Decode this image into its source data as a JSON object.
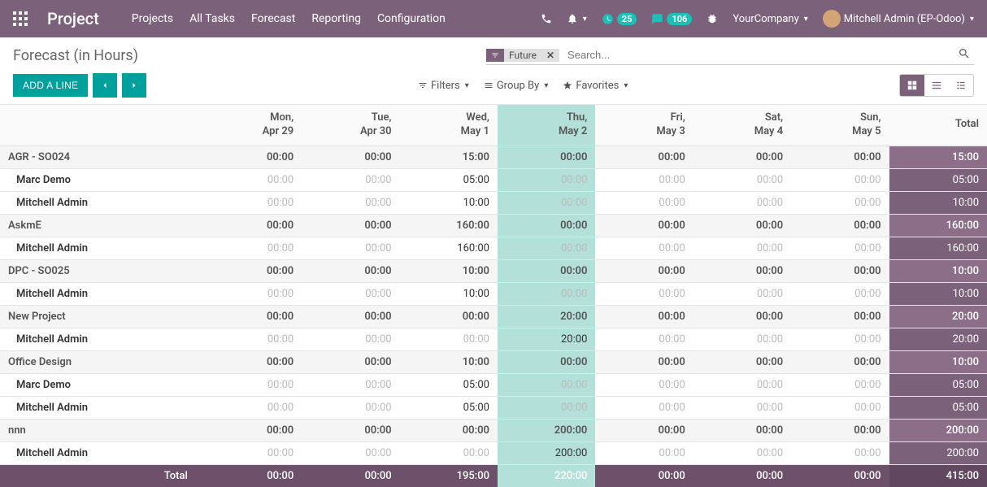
{
  "navbar": {
    "brand": "Project",
    "menu": [
      "Projects",
      "All Tasks",
      "Forecast",
      "Reporting",
      "Configuration"
    ],
    "activity_count": "25",
    "discuss_count": "106",
    "company": "YourCompany",
    "user": "Mitchell Admin (EP-Odoo)"
  },
  "page": {
    "title": "Forecast (in Hours)",
    "add_line": "ADD A LINE",
    "search_placeholder": "Search...",
    "facet_label": "Future",
    "filters": "Filters",
    "group_by": "Group By",
    "favorites": "Favorites"
  },
  "columns": [
    {
      "l1": "Mon,",
      "l2": "Apr 29",
      "today": false
    },
    {
      "l1": "Tue,",
      "l2": "Apr 30",
      "today": false
    },
    {
      "l1": "Wed,",
      "l2": "May 1",
      "today": false
    },
    {
      "l1": "Thu,",
      "l2": "May 2",
      "today": true
    },
    {
      "l1": "Fri,",
      "l2": "May 3",
      "today": false
    },
    {
      "l1": "Sat,",
      "l2": "May 4",
      "today": false
    },
    {
      "l1": "Sun,",
      "l2": "May 5",
      "today": false
    }
  ],
  "total_label": "Total",
  "groups": [
    {
      "name": "AGR - SO024",
      "cells": [
        "00:00",
        "00:00",
        "15:00",
        "00:00",
        "00:00",
        "00:00",
        "00:00"
      ],
      "total": "15:00",
      "rows": [
        {
          "name": "Marc Demo",
          "cells": [
            "00:00",
            "00:00",
            "05:00",
            "00:00",
            "00:00",
            "00:00",
            "00:00"
          ],
          "total": "05:00",
          "nz": [
            2
          ]
        },
        {
          "name": "Mitchell Admin",
          "cells": [
            "00:00",
            "00:00",
            "10:00",
            "00:00",
            "00:00",
            "00:00",
            "00:00"
          ],
          "total": "10:00",
          "nz": [
            2
          ]
        }
      ]
    },
    {
      "name": "AskmE",
      "cells": [
        "00:00",
        "00:00",
        "160:00",
        "00:00",
        "00:00",
        "00:00",
        "00:00"
      ],
      "total": "160:00",
      "rows": [
        {
          "name": "Mitchell Admin",
          "cells": [
            "00:00",
            "00:00",
            "160:00",
            "00:00",
            "00:00",
            "00:00",
            "00:00"
          ],
          "total": "160:00",
          "nz": [
            2
          ]
        }
      ]
    },
    {
      "name": "DPC - SO025",
      "cells": [
        "00:00",
        "00:00",
        "10:00",
        "00:00",
        "00:00",
        "00:00",
        "00:00"
      ],
      "total": "10:00",
      "rows": [
        {
          "name": "Mitchell Admin",
          "cells": [
            "00:00",
            "00:00",
            "10:00",
            "00:00",
            "00:00",
            "00:00",
            "00:00"
          ],
          "total": "10:00",
          "nz": [
            2
          ]
        }
      ]
    },
    {
      "name": "New Project",
      "cells": [
        "00:00",
        "00:00",
        "00:00",
        "20:00",
        "00:00",
        "00:00",
        "00:00"
      ],
      "total": "20:00",
      "rows": [
        {
          "name": "Mitchell Admin",
          "cells": [
            "00:00",
            "00:00",
            "00:00",
            "20:00",
            "00:00",
            "00:00",
            "00:00"
          ],
          "total": "20:00",
          "nz": [
            3
          ]
        }
      ]
    },
    {
      "name": "Office Design",
      "cells": [
        "00:00",
        "00:00",
        "10:00",
        "00:00",
        "00:00",
        "00:00",
        "00:00"
      ],
      "total": "10:00",
      "rows": [
        {
          "name": "Marc Demo",
          "cells": [
            "00:00",
            "00:00",
            "05:00",
            "00:00",
            "00:00",
            "00:00",
            "00:00"
          ],
          "total": "05:00",
          "nz": [
            2
          ]
        },
        {
          "name": "Mitchell Admin",
          "cells": [
            "00:00",
            "00:00",
            "05:00",
            "00:00",
            "00:00",
            "00:00",
            "00:00"
          ],
          "total": "05:00",
          "nz": [
            2
          ]
        }
      ]
    },
    {
      "name": "nnn",
      "cells": [
        "00:00",
        "00:00",
        "00:00",
        "200:00",
        "00:00",
        "00:00",
        "00:00"
      ],
      "total": "200:00",
      "rows": [
        {
          "name": "Mitchell Admin",
          "cells": [
            "00:00",
            "00:00",
            "00:00",
            "200:00",
            "00:00",
            "00:00",
            "00:00"
          ],
          "total": "200:00",
          "nz": [
            3
          ]
        }
      ]
    }
  ],
  "footer": {
    "label": "Total",
    "cells": [
      "00:00",
      "00:00",
      "195:00",
      "220:00",
      "00:00",
      "00:00",
      "00:00"
    ],
    "total": "415:00"
  }
}
